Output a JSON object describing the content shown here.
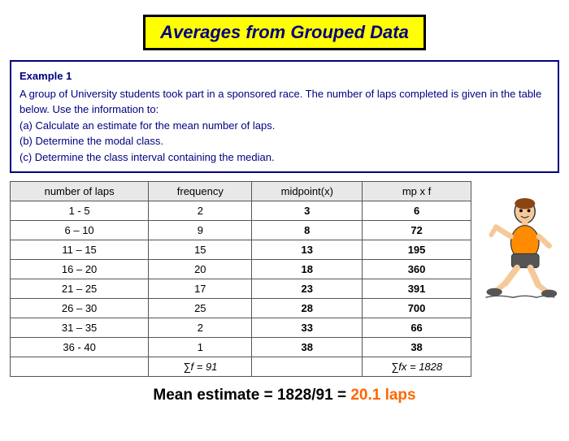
{
  "title": "Averages from Grouped Data",
  "example": {
    "title": "Example 1",
    "text_lines": [
      "A group of University students took part in a sponsored race. The number of",
      "laps completed is given in the table below. Use the information to:",
      "(a) Calculate an estimate for the mean number of laps.",
      "(b) Determine the modal class.",
      "(c) Determine the class interval containing the median."
    ]
  },
  "table": {
    "headers": [
      "number of laps",
      "frequency",
      "midpoint(x)",
      "mp x f"
    ],
    "rows": [
      {
        "laps": "1 - 5",
        "freq": "2",
        "mid": "3",
        "mpf": "6"
      },
      {
        "laps": "6 – 10",
        "freq": "9",
        "mid": "8",
        "mpf": "72"
      },
      {
        "laps": "11 – 15",
        "freq": "15",
        "mid": "13",
        "mpf": "195"
      },
      {
        "laps": "16 – 20",
        "freq": "20",
        "mid": "18",
        "mpf": "360"
      },
      {
        "laps": "21 – 25",
        "freq": "17",
        "mid": "23",
        "mpf": "391"
      },
      {
        "laps": "26 – 30",
        "freq": "25",
        "mid": "28",
        "mpf": "700"
      },
      {
        "laps": "31 – 35",
        "freq": "2",
        "mid": "33",
        "mpf": "66"
      },
      {
        "laps": "36 - 40",
        "freq": "1",
        "mid": "38",
        "mpf": "38"
      }
    ],
    "sum_freq": "∑f = 91",
    "sum_mpf": "∑fx = 1828"
  },
  "mean_estimate": {
    "prefix": "Mean estimate = 1828/91 = ",
    "value": "20.1 laps"
  }
}
